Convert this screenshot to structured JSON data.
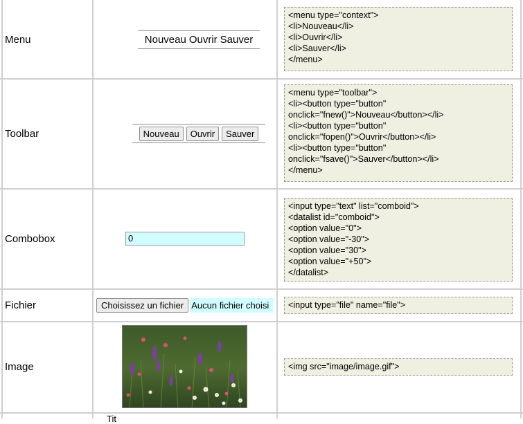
{
  "rows": {
    "menu": {
      "label": "Menu",
      "items": [
        "Nouveau",
        "Ouvrir",
        "Sauver"
      ],
      "code": "<menu type=\"context\">\n<li>Nouveau</li>\n<li>Ouvrir</li>\n<li>Sauver</li>\n</menu>"
    },
    "toolbar": {
      "label": "Toolbar",
      "buttons": [
        "Nouveau",
        "Ouvrir",
        "Sauver"
      ],
      "code": "<menu type=\"toolbar\">\n<li><button type=\"button\"\nonclick=\"fnew()\">Nouveau</button></li>\n<li><button type=\"button\"\nonclick=\"fopen()\">Ouvrir</button></li>\n<li><button type=\"button\"\nonclick=\"fsave()\">Sauver</button></li>\n</menu>"
    },
    "combobox": {
      "label": "Combobox",
      "value": "0",
      "code": "<input type=\"text\" list=\"comboid\">\n<datalist id=\"comboid\">\n<option value=\"0\">\n<option value=\"-30\">\n<option value=\"30\">\n<option value=\"+50\">\n</datalist>"
    },
    "fichier": {
      "label": "Fichier",
      "button_label": "Choisissez un fichier",
      "status": "Aucun fichier choisi",
      "code": "<input type=\"file\" name=\"file\">"
    },
    "image": {
      "label": "Image",
      "code": "<img src=\"image/image.gif\">"
    },
    "next": {
      "partial_text": "Tit"
    }
  }
}
